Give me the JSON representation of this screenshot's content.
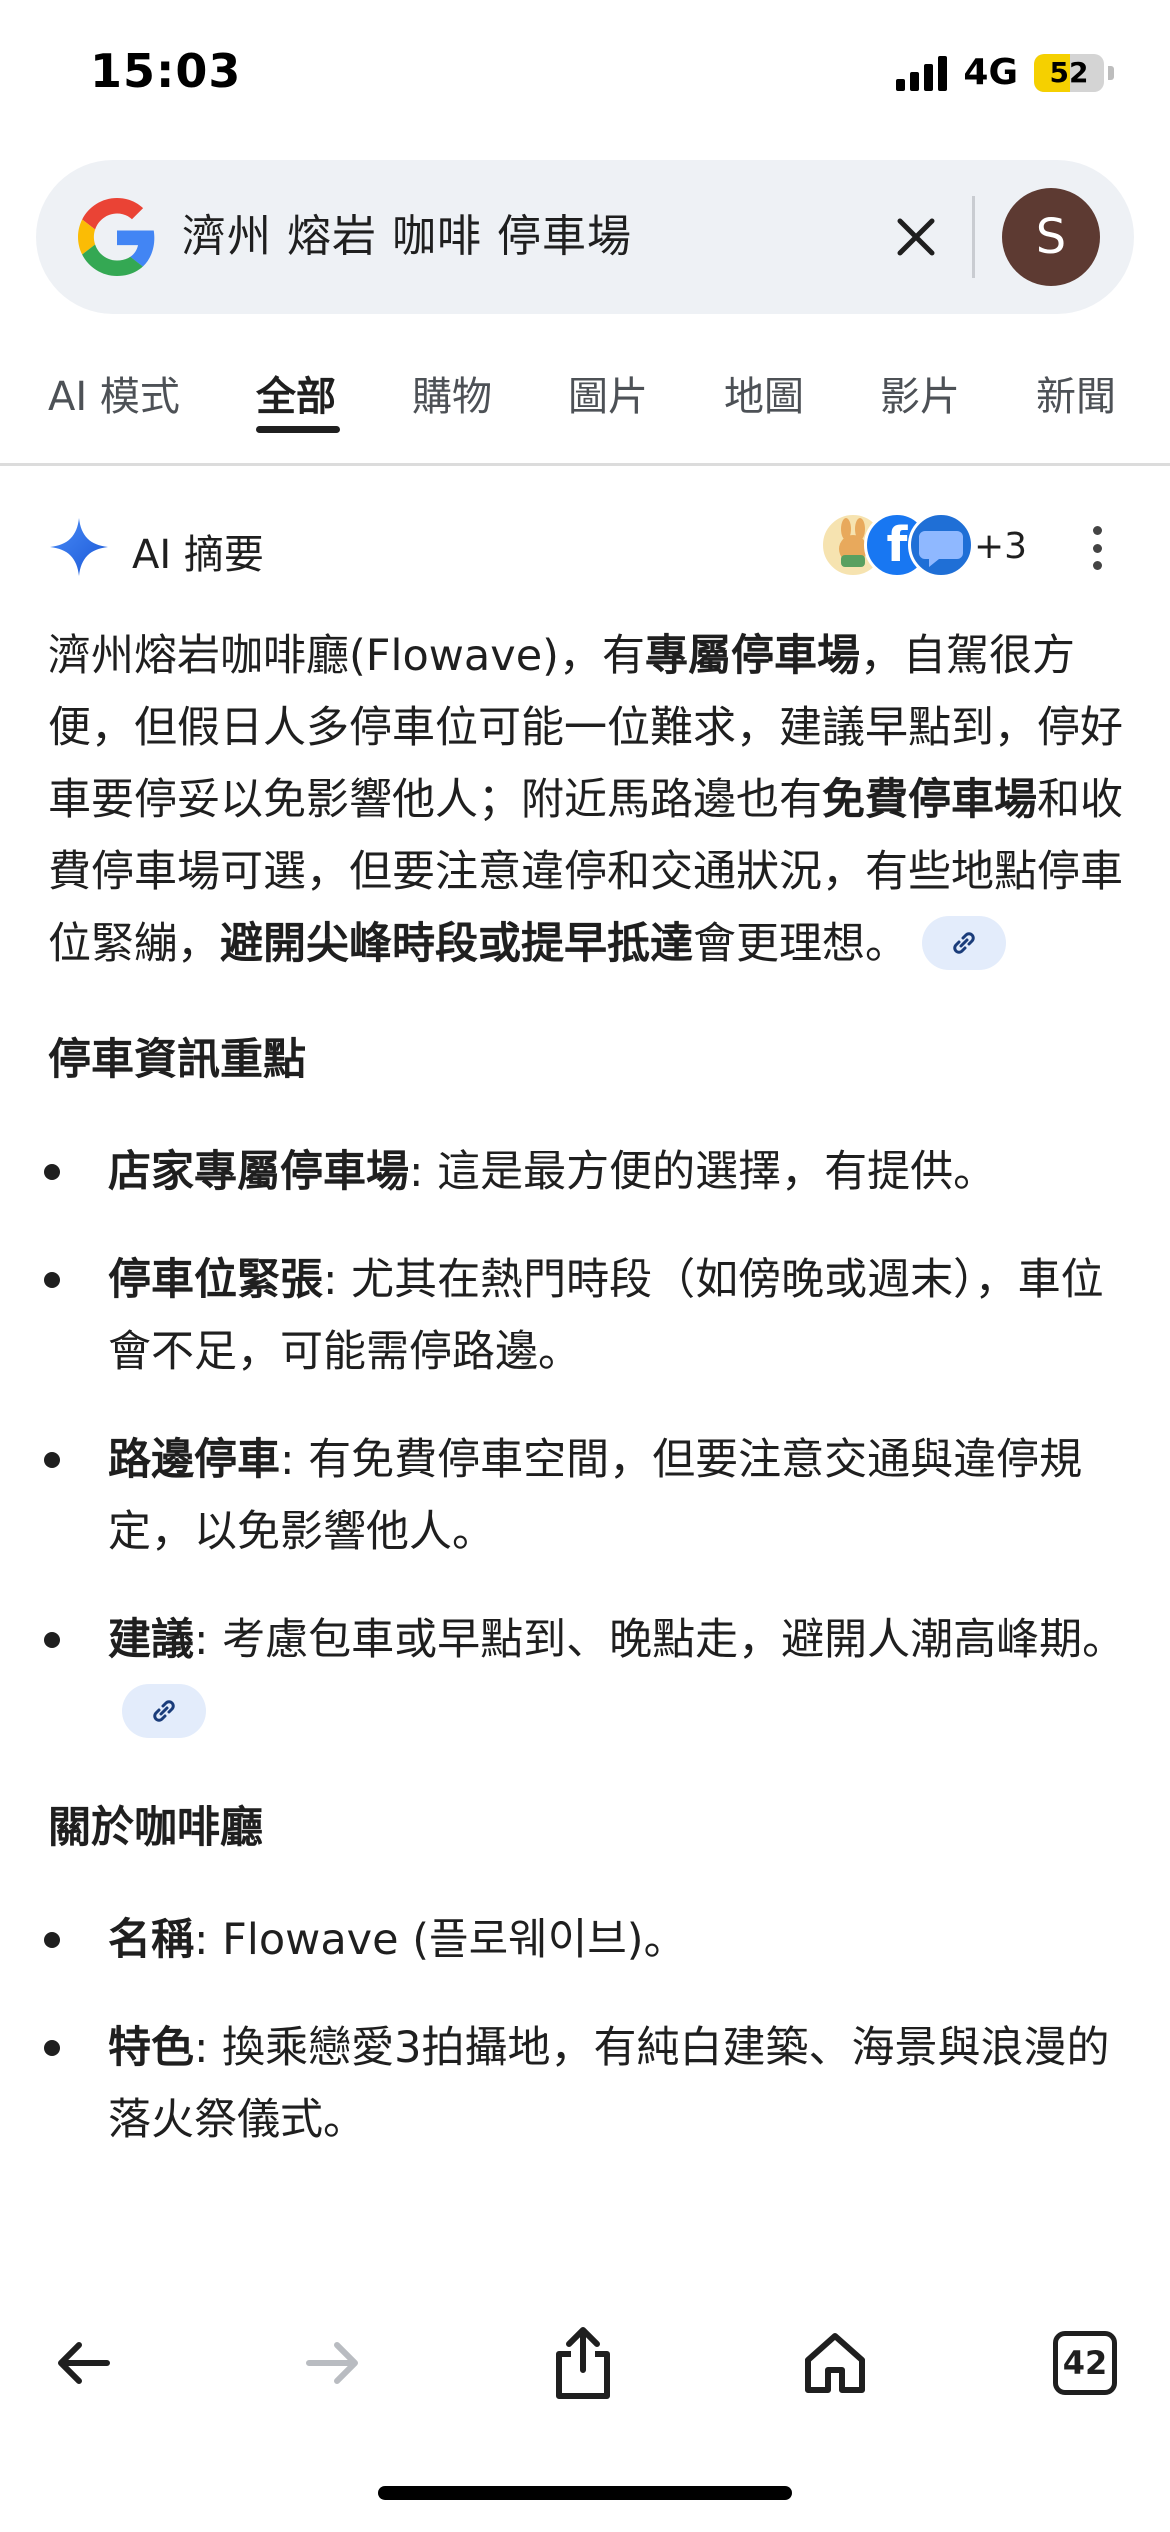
{
  "status_bar": {
    "time": "15:03",
    "network": "4G",
    "battery": "52",
    "battery_level_percent": 52
  },
  "search": {
    "query": "濟州 熔岩 咖啡  停車場",
    "avatar_letter": "S"
  },
  "tabs": [
    {
      "label": "AI 模式"
    },
    {
      "label": "全部",
      "active": true
    },
    {
      "label": "購物"
    },
    {
      "label": "圖片"
    },
    {
      "label": "地圖"
    },
    {
      "label": "影片"
    },
    {
      "label": "新聞"
    }
  ],
  "ai_overview": {
    "title": "AI 摘要",
    "source_count": "+3",
    "intro": {
      "t1": "濟州熔岩咖啡廳(Flowave)，有",
      "b1": "專屬停車場",
      "t2": "，自駕很方便，但假日人多停車位可能一位難求，建議早點到，停好車要停妥以免影響他人；附近馬路邊也有",
      "b2": "免費停車場",
      "t3": "和收費停車場可選，但要注意違停和交通狀況，有些地點停車位緊繃，",
      "b3": "避開尖峰時段或提早抵達",
      "t4": "會更理想。"
    },
    "parking_section": {
      "title": "停車資訊重點",
      "items": [
        {
          "label": "店家專屬停車場",
          "text": ": 這是最方便的選擇，有提供。"
        },
        {
          "label": "停車位緊張",
          "text": ": 尤其在熱門時段（如傍晚或週末），車位會不足，可能需停路邊。"
        },
        {
          "label": "路邊停車",
          "text": ": 有免費停車空間，但要注意交通與違停規定，以免影響他人。"
        },
        {
          "label": "建議",
          "text": ": 考慮包車或早點到、晚點走，避開人潮高峰期。"
        }
      ]
    },
    "cafe_section": {
      "title": "關於咖啡廳",
      "items": [
        {
          "label": "名稱",
          "text": ": Flowave (플로웨이브)。"
        },
        {
          "label": "特色",
          "text": ": 換乘戀愛3拍攝地，有純白建築、海景與浪漫的落火祭儀式。"
        }
      ]
    }
  },
  "toolbar": {
    "tab_count": "42"
  },
  "colors": {
    "search_bg": "#eef1f5",
    "avatar_bg": "#5d3a32",
    "link_chip_bg": "#e3ecfb",
    "battery_fill": "#f5d000"
  }
}
